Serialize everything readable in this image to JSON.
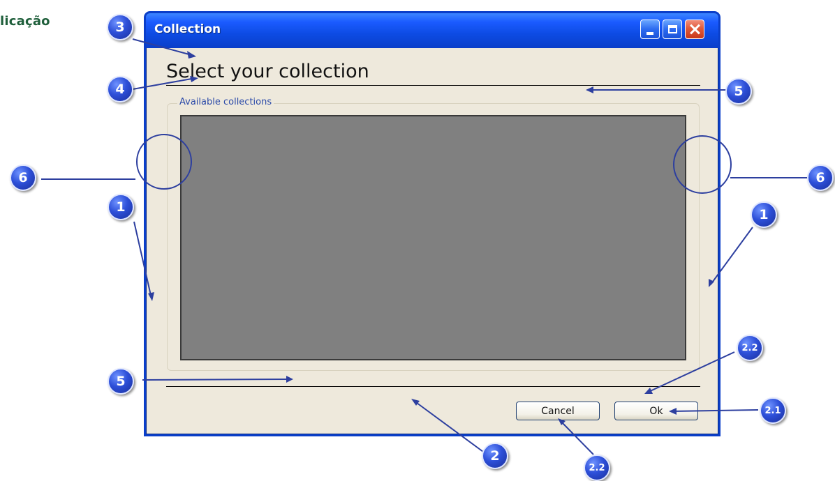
{
  "page": {
    "heading": "licação"
  },
  "window": {
    "title": "Collection",
    "controls": {
      "minimize_icon": "minimize-icon",
      "maximize_icon": "maximize-icon",
      "close_icon": "close-icon"
    }
  },
  "dialog": {
    "heading": "Select your collection",
    "group_label": "Available collections",
    "buttons": {
      "cancel_label": "Cancel",
      "ok_label": "Ok"
    }
  },
  "annotations": {
    "callouts": {
      "c3": "3",
      "c4": "4",
      "c5_top": "5",
      "c5_bottom": "5",
      "c6_left": "6",
      "c6_right": "6",
      "c1_left": "1",
      "c1_right": "1",
      "c22_top": "2.2",
      "c21": "2.1",
      "c22_bottom": "2.2",
      "c2": "2"
    }
  },
  "colors": {
    "title_bar": "#0d4be3",
    "window_border": "#0a3ec9",
    "dialog_bg": "#eee9dc",
    "list_bg": "#808080",
    "annotation": "#2d4fd8",
    "heading_green": "#1f5f3b"
  }
}
